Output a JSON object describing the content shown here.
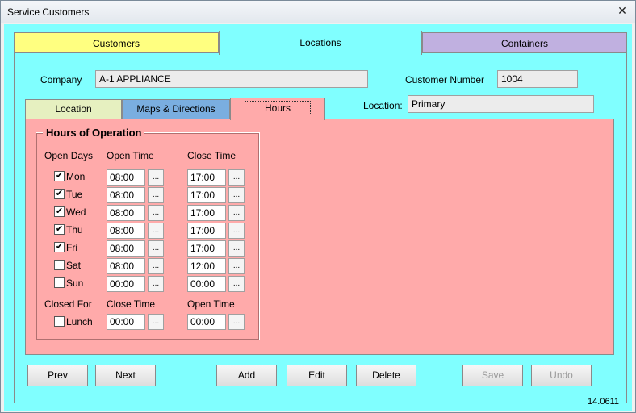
{
  "window": {
    "title": "Service Customers"
  },
  "main_tabs": [
    {
      "label": "Customers"
    },
    {
      "label": "Locations"
    },
    {
      "label": "Containers"
    }
  ],
  "company": {
    "label": "Company",
    "value": "A-1 APPLIANCE"
  },
  "customer_number": {
    "label": "Customer Number",
    "value": "1004"
  },
  "location": {
    "label": "Location:",
    "value": "Primary"
  },
  "sub_tabs": [
    {
      "label": "Location"
    },
    {
      "label": "Maps & Directions"
    },
    {
      "label": "Hours"
    }
  ],
  "hours": {
    "group_title": "Hours of Operation",
    "col_open_days": "Open Days",
    "col_open_time": "Open Time",
    "col_close_time": "Close Time",
    "days": [
      {
        "name": "Mon",
        "checked": true,
        "open": "08:00",
        "close": "17:00"
      },
      {
        "name": "Tue",
        "checked": true,
        "open": "08:00",
        "close": "17:00"
      },
      {
        "name": "Wed",
        "checked": true,
        "open": "08:00",
        "close": "17:00"
      },
      {
        "name": "Thu",
        "checked": true,
        "open": "08:00",
        "close": "17:00"
      },
      {
        "name": "Fri",
        "checked": true,
        "open": "08:00",
        "close": "17:00"
      },
      {
        "name": "Sat",
        "checked": false,
        "open": "08:00",
        "close": "12:00"
      },
      {
        "name": "Sun",
        "checked": false,
        "open": "00:00",
        "close": "00:00"
      }
    ],
    "closed_for": {
      "col_closed_for": "Closed For",
      "col_close_time": "Close Time",
      "col_open_time": "Open Time",
      "name": "Lunch",
      "checked": false,
      "close": "00:00",
      "open": "00:00"
    },
    "picker_label": "..."
  },
  "buttons": {
    "prev": "Prev",
    "next": "Next",
    "add": "Add",
    "edit": "Edit",
    "delete": "Delete",
    "save": "Save",
    "undo": "Undo"
  },
  "close_glyph": "✕",
  "check_glyph": "✔",
  "version": "14.0611"
}
